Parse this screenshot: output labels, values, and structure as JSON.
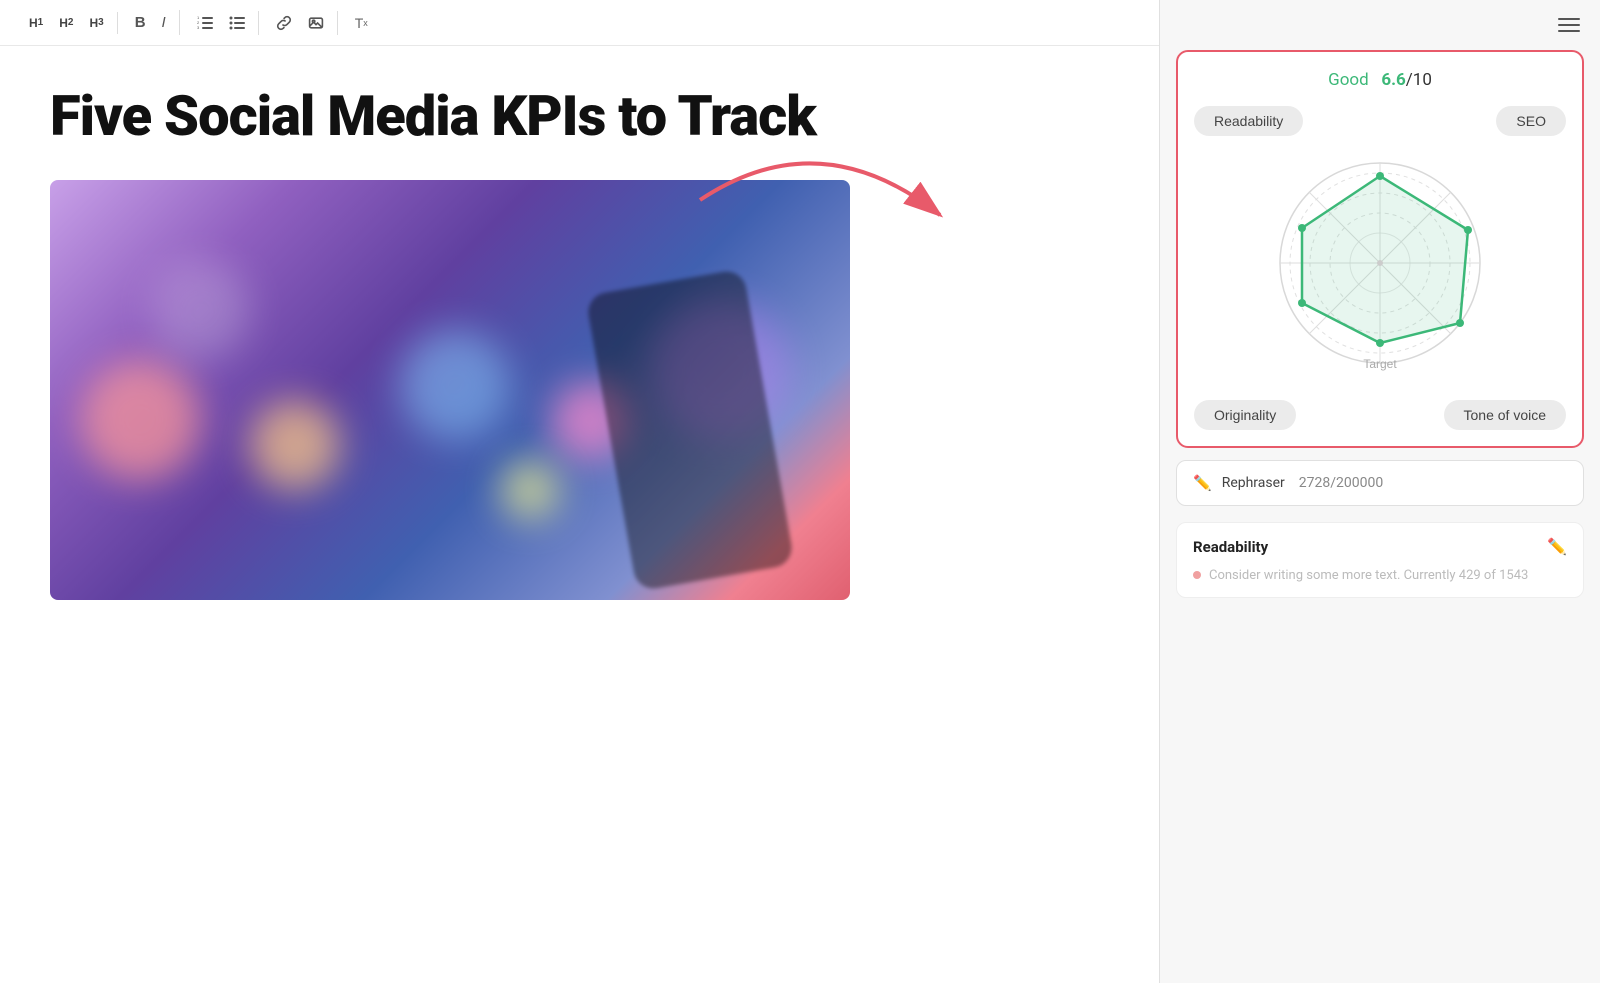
{
  "toolbar": {
    "headings": [
      "H1",
      "H2",
      "H3"
    ],
    "format": [
      "B",
      "I"
    ],
    "lists": [
      "ordered-list",
      "unordered-list"
    ],
    "insert": [
      "link",
      "image"
    ],
    "clear": "Tx"
  },
  "editor": {
    "title": "Five Social Media KPIs to Track"
  },
  "score_card": {
    "label": "Good",
    "score": "6.6",
    "denom": "/10",
    "tab_readability": "Readability",
    "tab_seo": "SEO",
    "target_label": "Target",
    "tab_originality": "Originality",
    "tab_tone": "Tone of voice"
  },
  "rephraser": {
    "label": "Rephraser",
    "count": "2728/200000"
  },
  "readability": {
    "title": "Readability",
    "hint": "Consider writing some more text. Currently 429 of 1543"
  },
  "hamburger": "menu"
}
